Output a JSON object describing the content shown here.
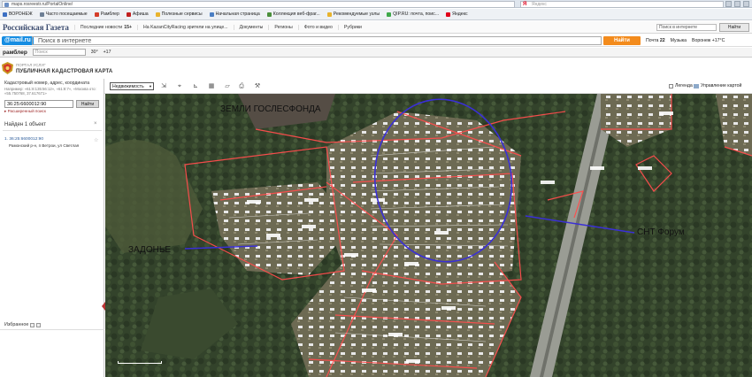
{
  "browser": {
    "url": "maps.rosreestr.ru/PortalOnline/",
    "search_placeholder": "Яндекс",
    "bookmarks": [
      {
        "label": "ВОРОНЕЖ",
        "color": "#3b6fc3"
      },
      {
        "label": "Часто посещаемые",
        "color": "#6d7f95"
      },
      {
        "label": "Рамблер",
        "color": "#d43d2a"
      },
      {
        "label": "Афиша",
        "color": "#c02020"
      },
      {
        "label": "Полезные сервисы",
        "color": "#e8b32d"
      },
      {
        "label": "Начальная страница",
        "color": "#4b7ec3"
      },
      {
        "label": "Коллекция веб-фраг...",
        "color": "#4a8f3c"
      },
      {
        "label": "Рекомендуемые узлы",
        "color": "#e8b32d"
      },
      {
        "label": "QIP.RU: почта, поис...",
        "color": "#3ea84a"
      },
      {
        "label": "Яндекс",
        "color": "#e0001a"
      }
    ]
  },
  "rg_bar": {
    "logo": "Российская Газета",
    "latest_news": "Последние новости",
    "age": "15+",
    "item2": "На KazanCityRacing зрители на улице...",
    "docs": "Документы",
    "regions": "Регионы",
    "photo": "Фото и видео",
    "rubrics": "Рубрики",
    "dropdown": "Поиск в интернете",
    "find": "Найти"
  },
  "mail_bar": {
    "logo": "@mail.ru",
    "placeholder": "Поиск в интернете",
    "find": "Найти",
    "mail": "Почта",
    "mail_count": "22",
    "music": "Музыка",
    "weather": "Воронеж +17°С"
  },
  "rambler_bar": {
    "logo": "рамблер",
    "search": "Поиск",
    "weather": "30°",
    "count": "+17"
  },
  "portal": {
    "small": "ПОРТАЛ УСЛУГ",
    "title": "ПУБЛИЧНАЯ КАДАСТРОВАЯ КАРТА"
  },
  "sidebar": {
    "hint": "Кадастровый номер, адрес, координата",
    "hint_example": "Например: «61:8:135:56:12», «61:8:7», «Москва ото: «55.750768, 37.617671»",
    "search_value": "36:25:6600012:90",
    "find": "Найти",
    "advanced": "Расширенный поиск",
    "found": "Найден 1 объект",
    "result_number": "1. 36:25:6600012:90",
    "result_address": "Рамонский р-н, п Ветрои, ул Светлая",
    "favorites": "Избранное"
  },
  "toolbar": {
    "layer": "Недвижимость",
    "legend": "Легенда",
    "map_control": "Управление картой"
  },
  "map": {
    "label_zemli": "ЗЕМЛИ ГОСЛЕСФОНДА",
    "label_zadone": "ЗАДОНЬЕ",
    "label_snt": "СНТ Форум"
  }
}
